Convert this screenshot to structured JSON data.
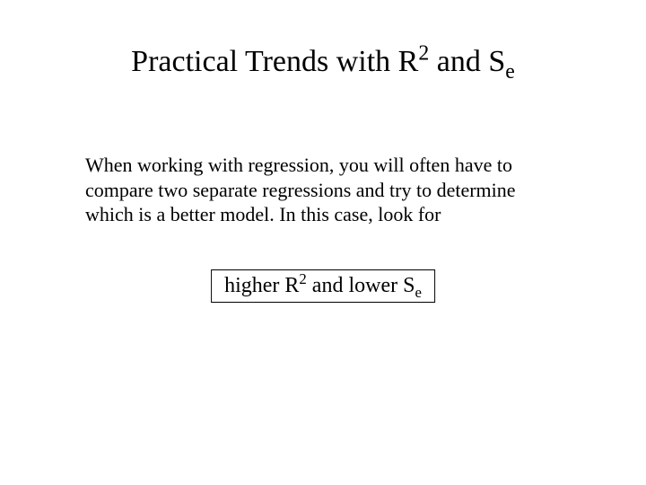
{
  "title": {
    "pre": "Practical Trends with R",
    "sup": "2",
    "mid": " and S",
    "sub": "e"
  },
  "body": "When working with regression, you will often have to compare two separate regressions and try to determine which is a better model. In this case, look for",
  "boxed": {
    "pre": "higher R",
    "sup": "2",
    "mid": " and lower S",
    "sub": "e"
  }
}
